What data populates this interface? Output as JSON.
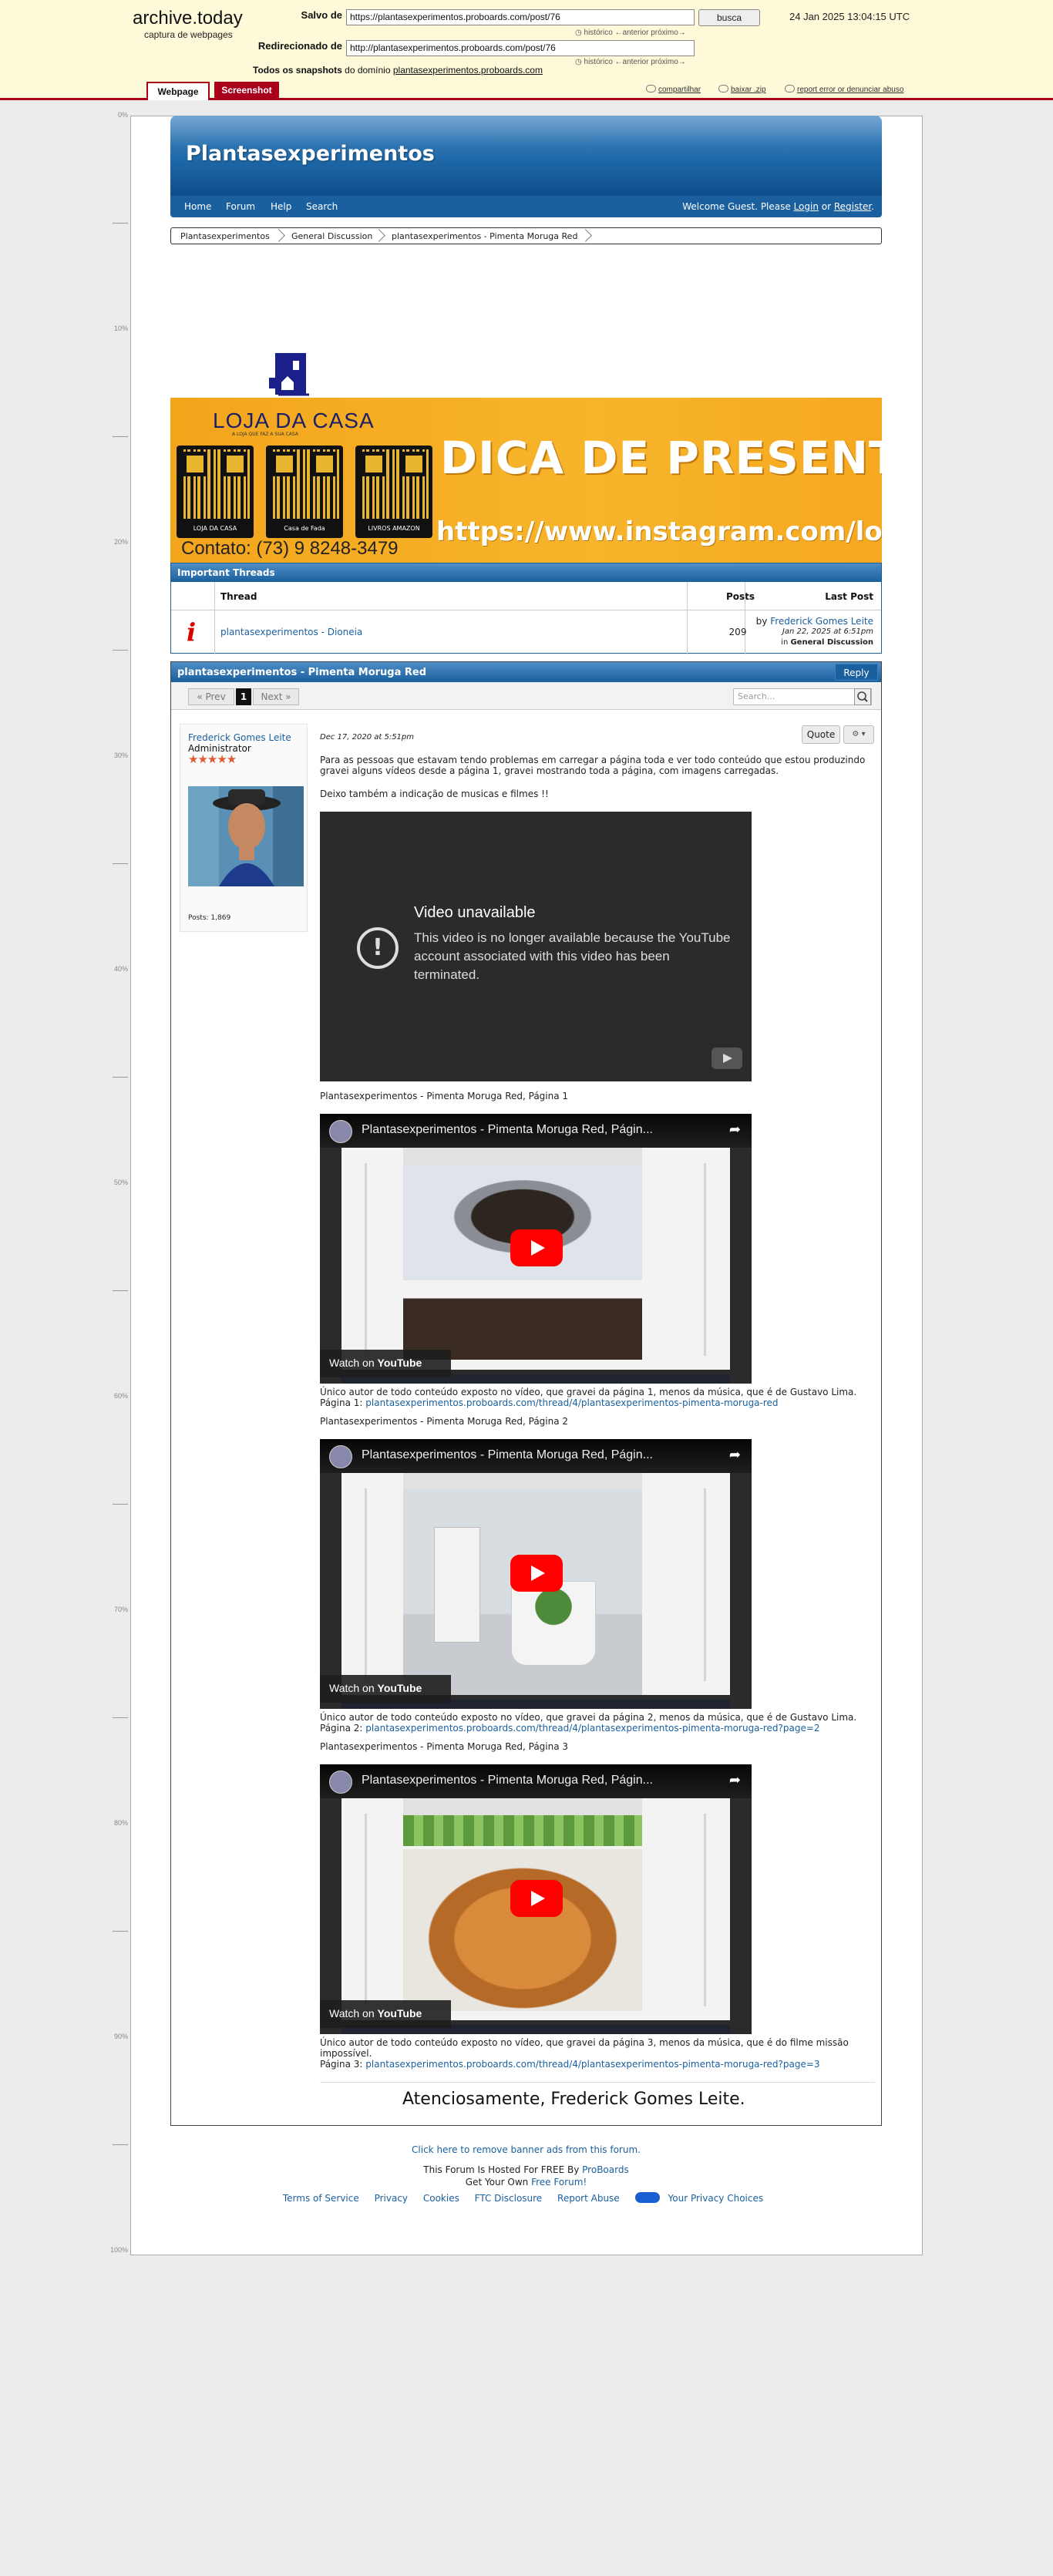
{
  "archive": {
    "logo": "archive.today",
    "subtitle": "captura de webpages",
    "saved_label": "Salvo de",
    "saved_url": "https://plantasexperimentos.proboards.com/post/76",
    "search_button": "busca",
    "date": "24 Jan 2025 13:04:15 UTC",
    "history_line_1": "histórico ←anterior próximo→",
    "redirect_label": "Redirecionado de",
    "redirect_url": "http://plantasexperimentos.proboards.com/post/76",
    "history_line_2": "histórico ←anterior próximo→",
    "snapshots_prefix": "Todos os snapshots",
    "snapshots_middle": "do domínio",
    "snapshots_domain": "plantasexperimentos.proboards.com",
    "tab_webpage": "Webpage",
    "tab_screenshot": "Screenshot",
    "action_share": "compartilhar",
    "action_download": "baixar .zip",
    "action_report": "report error or denunciar abuso"
  },
  "ruler": [
    "0%",
    "10%",
    "20%",
    "30%",
    "40%",
    "50%",
    "60%",
    "70%",
    "80%",
    "90%",
    "100%"
  ],
  "forum": {
    "title": "Plantasexperimentos",
    "nav": [
      "Home",
      "Forum",
      "Help",
      "Search"
    ],
    "welcome_prefix": "Welcome Guest. Please ",
    "login": "Login",
    "or": " or ",
    "register": "Register",
    "welcome_suffix": "."
  },
  "breadcrumb": [
    "Plantasexperimentos",
    "General Discussion",
    "plantasexperimentos - Pimenta Moruga Red"
  ],
  "ad": {
    "store_name": "LOJA DA CASA",
    "store_sub": "A LOJA QUE FAZ A SUA CASA",
    "qr_labels": [
      "LOJA DA CASA",
      "Casa de Fada",
      "LIVROS AMAZON"
    ],
    "contact": "Contato: (73) 9 8248-3479",
    "headline": "DICA DE PRESENTE",
    "url": "https://www.instagram.com/lo"
  },
  "important_threads": {
    "header": "Important Threads",
    "col_thread": "Thread",
    "col_posts": "Posts",
    "col_last_post": "Last Post",
    "thread_title": "plantasexperimentos - Dioneia",
    "posts": "209",
    "last_by": "by ",
    "last_author": "Frederick Gomes Leite",
    "last_date": "Jan 22, 2025 at 6:51pm",
    "last_in": "in ",
    "last_board": "General Discussion"
  },
  "thread": {
    "title": "plantasexperimentos - Pimenta Moruga Red",
    "reply": "Reply",
    "prev": "« Prev",
    "page": "1",
    "next": "Next »",
    "search_placeholder": "Search..."
  },
  "post": {
    "author": "Frederick Gomes Leite",
    "role": "Administrator",
    "stars": "★★★★★",
    "posts_count": "Posts: 1,869",
    "date": "Dec 17, 2020 at 5:51pm",
    "quote": "Quote",
    "intro": "Para as pessoas que estavam tendo problemas em carregar a página toda e ver todo conteúdo que estou produzindo gravei alguns vídeos desde a página 1, gravei mostrando toda a página, com imagens carregadas.",
    "intro2": "Deixo também a indicação de musicas e filmes !!",
    "unavailable_title": "Video unavailable",
    "unavailable_msg": "This video is no longer available because the YouTube account associated with this video has been terminated.",
    "video_heading_1": "Plantasexperimentos - Pimenta Moruga Red, Página 1",
    "video_title_1": "Plantasexperimentos - Pimenta Moruga Red, Págin...",
    "caption_1": "Único autor de todo conteúdo exposto no vídeo, que gravei da página 1, menos da música, que é de Gustavo Lima.",
    "link_prefix_1": "Página 1: ",
    "link_1": "plantasexperimentos.proboards.com/thread/4/plantasexperimentos-pimenta-moruga-red",
    "video_heading_2": "Plantasexperimentos - Pimenta Moruga Red, Página 2",
    "video_title_2": "Plantasexperimentos - Pimenta Moruga Red, Págin...",
    "caption_2": "Único autor de todo conteúdo exposto no vídeo, que gravei da página 2, menos da música, que é de Gustavo Lima.",
    "link_prefix_2": "Página 2: ",
    "link_2": "plantasexperimentos.proboards.com/thread/4/plantasexperimentos-pimenta-moruga-red?page=2",
    "video_heading_3": "Plantasexperimentos - Pimenta Moruga Red, Página 3",
    "video_title_3": "Plantasexperimentos - Pimenta Moruga Red, Págin...",
    "caption_3": "Único autor de todo conteúdo exposto no vídeo, que gravei da página 3, menos da música, que é do filme missão impossível.",
    "link_prefix_3": "Página 3: ",
    "link_3": "plantasexperimentos.proboards.com/thread/4/plantasexperimentos-pimenta-moruga-red?page=3",
    "watch_on": "Watch on ",
    "youtube": "YouTube",
    "signature": "Atenciosamente, Frederick Gomes Leite."
  },
  "footer": {
    "remove_ads": "Click here to remove banner ads from this forum.",
    "hosted_prefix": "This Forum Is Hosted For FREE By ",
    "hosted_link": "ProBoards",
    "own_prefix": "Get Your Own ",
    "own_link": "Free Forum!",
    "links": [
      "Terms of Service",
      "Privacy",
      "Cookies",
      "FTC Disclosure",
      "Report Abuse",
      "Your Privacy Choices"
    ]
  },
  "colors": {
    "archive_bg": "#fdf9d9",
    "archive_accent": "#a9001b",
    "forum_blue": "#1a5f9e",
    "ad_orange": "#f7b52b"
  }
}
